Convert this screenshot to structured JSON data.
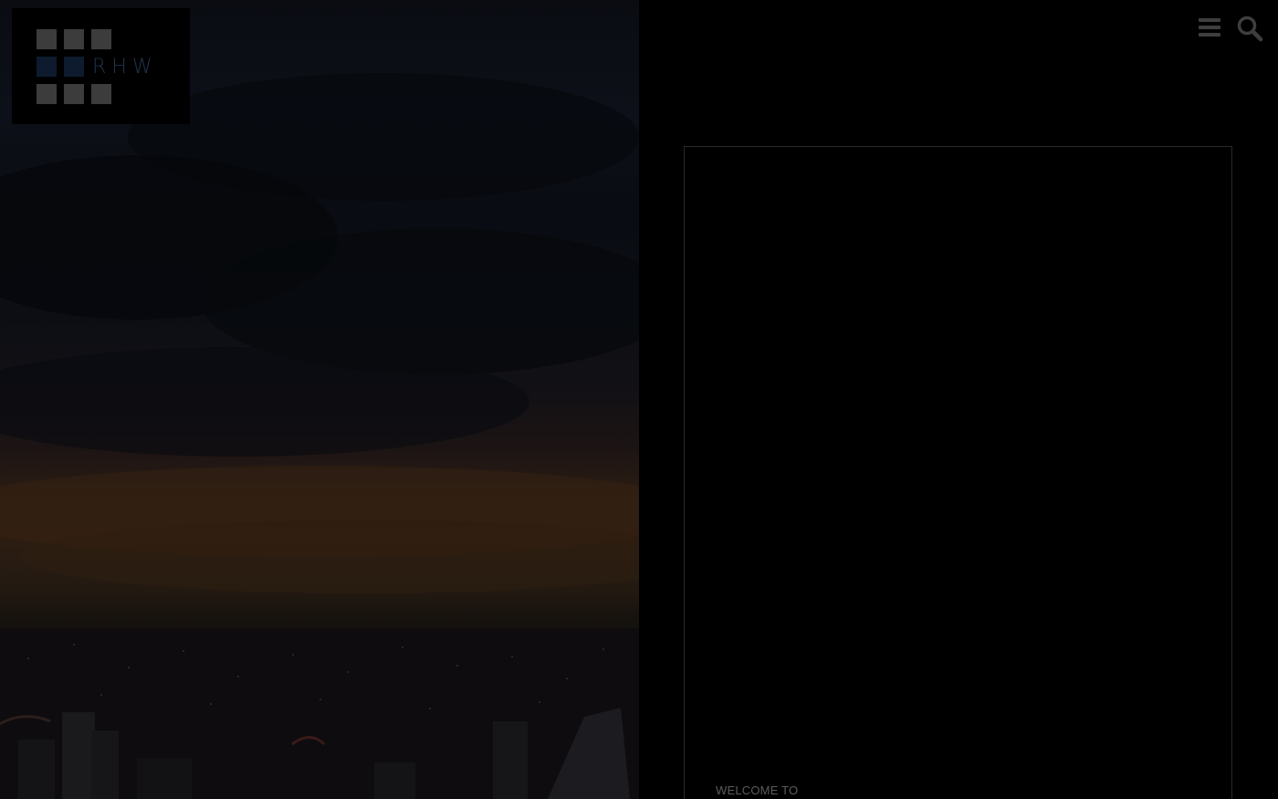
{
  "brand": {
    "logo_text": "RHW",
    "logo_grid_color": "#3c3c3c",
    "logo_accent_color": "#0e1b2e"
  },
  "header": {
    "menu_icon": "hamburger-menu-icon",
    "search_icon": "search-icon"
  },
  "hero": {
    "image": "city-skyline-at-dusk"
  },
  "panel": {
    "welcome_text": "WELCOME TO"
  },
  "colors": {
    "background": "#000000",
    "panel_border": "#2a2a2a",
    "icon_color": "#3e3e3e",
    "muted_text": "#5b5b5b"
  }
}
